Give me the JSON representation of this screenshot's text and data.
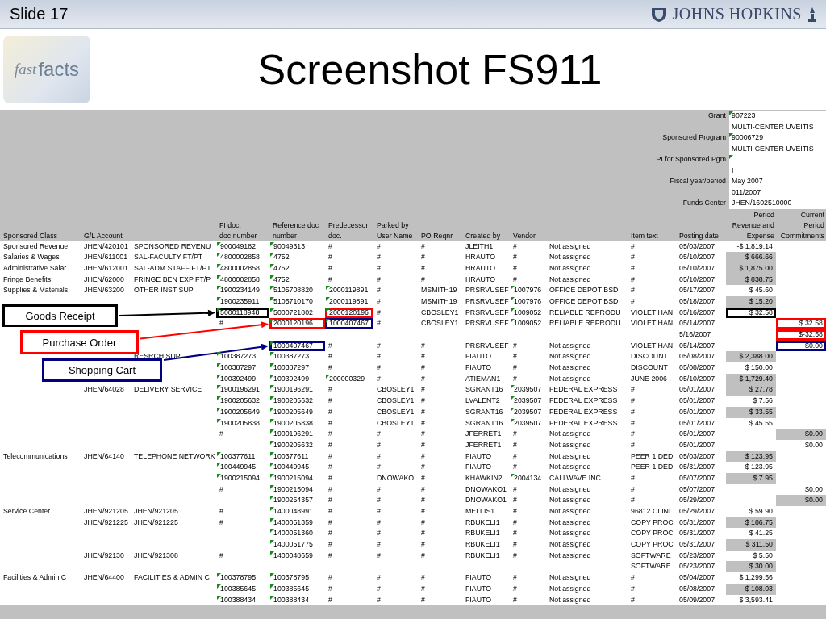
{
  "slide": {
    "label": "Slide 17",
    "brand": "JOHNS HOPKINS",
    "logo_words": [
      "fast",
      "facts"
    ],
    "title": "Screenshot FS911"
  },
  "report": {
    "info": [
      {
        "label": "Grant",
        "value": {
          "text": "907223",
          "flag": true
        }
      },
      {
        "value": "MULTI-CENTER UVEITIS"
      },
      {
        "label": "Sponsored Program",
        "value": {
          "text": "90006729",
          "flag": true
        }
      },
      {
        "value": "MULTI-CENTER UVEITIS"
      },
      {
        "label": "PI for Sponsored Pgm",
        "value": {
          "flag": true
        }
      },
      {
        "value": "I"
      },
      {
        "label": "Fiscal year/period",
        "value": "May 2007"
      },
      {
        "value": "011/2007"
      },
      {
        "label": "Funds Center",
        "value": "JHEN/1602510000"
      }
    ],
    "header": {
      "sponsored_class": "Sponsored Class",
      "gl_account": "G/L Account",
      "fi_doc": "FI doc:\ndoc.number",
      "reference_doc": "Reference doc\nnumber",
      "predecessor_doc": "Predecessor\ndoc.",
      "parked_by": "Parked by\nUser Name",
      "po_reqnr": "PO Reqnr",
      "created_by": "Created by",
      "vendor": "Vendor",
      "item_text": "Item text",
      "posting_date": "Posting date",
      "revenue_expense": "Period\nRevenue and\nExpense",
      "commitments": "Current\nPeriod\nCommitments"
    },
    "rows": [
      {
        "sponsored_class": "Sponsored Revenue",
        "gl_account": "JHEN/420101",
        "gl_account_text": "SPONSORED REVENU",
        "fi_doc": {
          "text": "900049182",
          "flag": true
        },
        "reference_doc": {
          "text": "90049313",
          "flag": true
        },
        "predecessor_doc": "#",
        "parked_by": "#",
        "po_reqnr": "#",
        "created_by": "JLEITH1",
        "vendor": "#",
        "vendor_name": "Not assigned",
        "item_text": "#",
        "posting_date": "05/03/2007",
        "revenue_expense": "-$ 1,819.14",
        "shaded": false
      },
      {
        "sponsored_class": "Salaries & Wages",
        "gl_account": "JHEN/611001",
        "gl_account_text": "SAL-FACULTY FT/PT",
        "fi_doc": {
          "text": "4800002858",
          "flag": true
        },
        "reference_doc": {
          "text": "4752",
          "flag": true
        },
        "predecessor_doc": "#",
        "parked_by": "#",
        "po_reqnr": "#",
        "created_by": "HRAUTO",
        "vendor": "#",
        "vendor_name": "Not assigned",
        "item_text": "#",
        "posting_date": "05/10/2007",
        "revenue_expense": "$ 666.66",
        "shaded": true
      },
      {
        "sponsored_class": "Administrative Salar",
        "gl_account": "JHEN/612001",
        "gl_account_text": "SAL-ADM STAFF FT/PT",
        "fi_doc": {
          "text": "4800002858",
          "flag": true
        },
        "reference_doc": {
          "text": "4752",
          "flag": true
        },
        "predecessor_doc": "#",
        "parked_by": "#",
        "po_reqnr": "#",
        "created_by": "HRAUTO",
        "vendor": "#",
        "vendor_name": "Not assigned",
        "item_text": "#",
        "posting_date": "05/10/2007",
        "revenue_expense": "$ 1,875.00",
        "shaded": true
      },
      {
        "sponsored_class": "Fringe Benefits",
        "gl_account": "JHEN/62000",
        "gl_account_text": "FRINGE BEN EXP FT/P",
        "fi_doc": {
          "text": "4800002858",
          "flag": true
        },
        "reference_doc": {
          "text": "4752",
          "flag": true
        },
        "predecessor_doc": "#",
        "parked_by": "#",
        "po_reqnr": "#",
        "created_by": "HRAUTO",
        "vendor": "#",
        "vendor_name": "Not assigned",
        "item_text": "#",
        "posting_date": "05/10/2007",
        "revenue_expense": "$ 838.75",
        "shaded": true
      },
      {
        "sponsored_class": "Supplies & Materials",
        "gl_account": "JHEN/63200",
        "gl_account_text": "OTHER INST SUP",
        "fi_doc": {
          "text": "1900234149",
          "flag": true
        },
        "reference_doc": {
          "text": "5105708820",
          "flag": true
        },
        "predecessor_doc": {
          "text": "2000119891",
          "flag": true
        },
        "parked_by": "#",
        "po_reqnr": "MSMITH19",
        "created_by": "PRSRVUSEF",
        "vendor": {
          "text": "1007976",
          "flag": true
        },
        "vendor_name": "OFFICE DEPOT BSD",
        "item_text": "#",
        "posting_date": "05/17/2007",
        "revenue_expense": "$ 45.60",
        "shaded": false
      },
      {
        "fi_doc": {
          "text": "1900235911",
          "flag": true
        },
        "reference_doc": {
          "text": "5105710170",
          "flag": true
        },
        "predecessor_doc": {
          "text": "2000119891",
          "flag": true
        },
        "parked_by": "#",
        "po_reqnr": "MSMITH19",
        "created_by": "PRSRVUSEF",
        "vendor": {
          "text": "1007976",
          "flag": true
        },
        "vendor_name": "OFFICE DEPOT BSD",
        "item_text": "#",
        "posting_date": "05/18/2007",
        "revenue_expense": "$ 15.20",
        "shaded": true
      },
      {
        "fi_doc": {
          "text": "5000118948",
          "flag": true,
          "color": "#000000"
        },
        "reference_doc": {
          "text": "5000721802",
          "flag": true
        },
        "predecessor_doc": {
          "text": "2000120196",
          "flag": true,
          "color": "#ff0000"
        },
        "parked_by": "#",
        "po_reqnr": "CBOSLEY1",
        "created_by": "PRSRVUSEF",
        "vendor": {
          "text": "1009052",
          "flag": true
        },
        "vendor_name": "RELIABLE REPRODU",
        "item_text": "VIOLET HAN",
        "posting_date": "05/16/2007",
        "revenue_expense": {
          "text": "$ 32.58",
          "color": "#000000"
        },
        "shaded": false
      },
      {
        "fi_doc": "#",
        "reference_doc": {
          "text": "2000120196",
          "flag": true,
          "color": "#ff0000"
        },
        "predecessor_doc": {
          "text": "1000407467",
          "flag": true,
          "color": "#000080"
        },
        "parked_by": "#",
        "po_reqnr": "CBOSLEY1",
        "created_by": "PRSRVUSEF",
        "vendor": {
          "text": "1009052",
          "flag": true
        },
        "vendor_name": "RELIABLE REPRODU",
        "item_text": "VIOLET HAN",
        "posting_date": "05/14/2007",
        "commitments": {
          "text": "$ 32.58",
          "color": "#ff0000"
        },
        "shaded": false
      },
      {
        "posting_date": "5/16/2007",
        "commitments": {
          "text": "$-32.58",
          "color": "#ff0000"
        },
        "shaded": false
      },
      {
        "reference_doc": {
          "text": "1000407467",
          "flag": true,
          "color": "#000080"
        },
        "predecessor_doc": "#",
        "parked_by": "#",
        "po_reqnr": "#",
        "created_by": "PRSRVUSEF",
        "vendor": "#",
        "vendor_name": "Not assigned",
        "item_text": "VIOLET HAN",
        "posting_date": "05/14/2007",
        "commitments": {
          "text": "$0.00",
          "color": "#000080"
        },
        "shaded": false
      },
      {
        "gl_account_text": "RESRCH SUP",
        "fi_doc": {
          "text": "100387273",
          "flag": true
        },
        "reference_doc": {
          "text": "100387273",
          "flag": true
        },
        "predecessor_doc": "#",
        "parked_by": "#",
        "po_reqnr": "#",
        "created_by": "FIAUTO",
        "vendor": "#",
        "vendor_name": "Not assigned",
        "item_text": "DISCOUNT",
        "posting_date": "05/08/2007",
        "revenue_expense": "$ 2,388.00",
        "shaded": true
      },
      {
        "fi_doc": {
          "text": "100387297",
          "flag": true
        },
        "reference_doc": {
          "text": "100387297",
          "flag": true
        },
        "predecessor_doc": "#",
        "parked_by": "#",
        "po_reqnr": "#",
        "created_by": "FIAUTO",
        "vendor": "#",
        "vendor_name": "Not assigned",
        "item_text": "DISCOUNT",
        "posting_date": "05/08/2007",
        "revenue_expense": "$ 150.00",
        "shaded": false
      },
      {
        "fi_doc": {
          "text": "100392499",
          "flag": true
        },
        "reference_doc": {
          "text": "100392499",
          "flag": true
        },
        "predecessor_doc": {
          "text": "200000329",
          "flag": true
        },
        "parked_by": "#",
        "po_reqnr": "#",
        "created_by": "ATIEMAN1",
        "vendor": "#",
        "vendor_name": "Not assigned",
        "item_text": "JUNE 2006 .",
        "posting_date": "05/10/2007",
        "revenue_expense": "$ 1,729.40",
        "shaded": true
      },
      {
        "gl_account": "JHEN/64028",
        "gl_account_text": "DELIVERY SERVICE",
        "fi_doc": {
          "text": "1900196291",
          "flag": true
        },
        "reference_doc": {
          "text": "1900196291",
          "flag": true
        },
        "predecessor_doc": "#",
        "parked_by": "CBOSLEY1",
        "po_reqnr": "#",
        "created_by": "SGRANT16",
        "vendor": {
          "text": "2039507",
          "flag": true
        },
        "vendor_name": "FEDERAL EXPRESS",
        "item_text": "#",
        "posting_date": "05/01/2007",
        "revenue_expense": "$ 27.78",
        "shaded": true
      },
      {
        "fi_doc": {
          "text": "1900205632",
          "flag": true
        },
        "reference_doc": {
          "text": "1900205632",
          "flag": true
        },
        "predecessor_doc": "#",
        "parked_by": "CBOSLEY1",
        "po_reqnr": "#",
        "created_by": "LVALENT2",
        "vendor": {
          "text": "2039507",
          "flag": true
        },
        "vendor_name": "FEDERAL EXPRESS",
        "item_text": "#",
        "posting_date": "05/01/2007",
        "revenue_expense": "$ 7.56",
        "shaded": false
      },
      {
        "fi_doc": {
          "text": "1900205649",
          "flag": true
        },
        "reference_doc": {
          "text": "1900205649",
          "flag": true
        },
        "predecessor_doc": "#",
        "parked_by": "CBOSLEY1",
        "po_reqnr": "#",
        "created_by": "SGRANT16",
        "vendor": {
          "text": "2039507",
          "flag": true
        },
        "vendor_name": "FEDERAL EXPRESS",
        "item_text": "#",
        "posting_date": "05/01/2007",
        "revenue_expense": "$ 33.55",
        "shaded": true
      },
      {
        "fi_doc": {
          "text": "1900205838",
          "flag": true
        },
        "reference_doc": {
          "text": "1900205838",
          "flag": true
        },
        "predecessor_doc": "#",
        "parked_by": "CBOSLEY1",
        "po_reqnr": "#",
        "created_by": "SGRANT16",
        "vendor": {
          "text": "2039507",
          "flag": true
        },
        "vendor_name": "FEDERAL EXPRESS",
        "item_text": "#",
        "posting_date": "05/01/2007",
        "revenue_expense": "$ 45.55",
        "shaded": false
      },
      {
        "fi_doc": "#",
        "reference_doc": {
          "text": "1900196291",
          "flag": true
        },
        "predecessor_doc": "#",
        "parked_by": "#",
        "po_reqnr": "#",
        "created_by": "JFERRET1",
        "vendor": "#",
        "vendor_name": "Not assigned",
        "item_text": "#",
        "posting_date": "05/01/2007",
        "commitments": "$0.00",
        "shaded": true
      },
      {
        "reference_doc": {
          "text": "1900205632",
          "flag": true
        },
        "predecessor_doc": "#",
        "parked_by": "#",
        "po_reqnr": "#",
        "created_by": "JFERRET1",
        "vendor": "#",
        "vendor_name": "Not assigned",
        "item_text": "#",
        "posting_date": "05/01/2007",
        "commitments": "$0.00",
        "shaded": false
      },
      {
        "sponsored_class": "Telecommunications",
        "gl_account": "JHEN/64140",
        "gl_account_text": "TELEPHONE NETWORK",
        "fi_doc": {
          "text": "100377611",
          "flag": true
        },
        "reference_doc": {
          "text": "100377611",
          "flag": true
        },
        "predecessor_doc": "#",
        "parked_by": "#",
        "po_reqnr": "#",
        "created_by": "FIAUTO",
        "vendor": "#",
        "vendor_name": "Not assigned",
        "item_text": "PEER 1 DEDI",
        "posting_date": "05/03/2007",
        "revenue_expense": "$ 123.95",
        "shaded": true
      },
      {
        "fi_doc": {
          "text": "100449945",
          "flag": true
        },
        "reference_doc": {
          "text": "100449945",
          "flag": true
        },
        "predecessor_doc": "#",
        "parked_by": "#",
        "po_reqnr": "#",
        "created_by": "FIAUTO",
        "vendor": "#",
        "vendor_name": "Not assigned",
        "item_text": "PEER 1 DEDI",
        "posting_date": "05/31/2007",
        "revenue_expense": "$ 123.95",
        "shaded": false
      },
      {
        "fi_doc": {
          "text": "1900215094",
          "flag": true
        },
        "reference_doc": {
          "text": "1900215094",
          "flag": true
        },
        "predecessor_doc": "#",
        "parked_by": "DNOWAKO",
        "po_reqnr": "#",
        "created_by": "KHAWKIN2",
        "vendor": {
          "text": "2004134",
          "flag": true
        },
        "vendor_name": "CALLWAVE INC",
        "item_text": "#",
        "posting_date": "05/07/2007",
        "revenue_expense": "$ 7.95",
        "shaded": true
      },
      {
        "fi_doc": "#",
        "reference_doc": {
          "text": "1900215094",
          "flag": true
        },
        "predecessor_doc": "#",
        "parked_by": "#",
        "po_reqnr": "#",
        "created_by": "DNOWAKO1",
        "vendor": "#",
        "vendor_name": "Not assigned",
        "item_text": "#",
        "posting_date": "05/07/2007",
        "commitments": "$0.00",
        "shaded": false
      },
      {
        "reference_doc": {
          "text": "1900254357",
          "flag": true
        },
        "predecessor_doc": "#",
        "parked_by": "#",
        "po_reqnr": "#",
        "created_by": "DNOWAKO1",
        "vendor": "#",
        "vendor_name": "Not assigned",
        "item_text": "#",
        "posting_date": "05/29/2007",
        "commitments": "$0.00",
        "shaded": true
      },
      {
        "sponsored_class": "Service Center",
        "gl_account": "JHEN/921205",
        "gl_account_text": "JHEN/921205",
        "fi_doc": "#",
        "reference_doc": {
          "text": "1400048991",
          "flag": true
        },
        "predecessor_doc": "#",
        "parked_by": "#",
        "po_reqnr": "#",
        "created_by": "MELLIS1",
        "vendor": "#",
        "vendor_name": "Not assigned",
        "item_text": "96812 CLINI",
        "posting_date": "05/29/2007",
        "revenue_expense": "$ 59.90",
        "shaded": false
      },
      {
        "gl_account": "JHEN/921225",
        "gl_account_text": "JHEN/921225",
        "fi_doc": "#",
        "reference_doc": {
          "text": "1400051359",
          "flag": true
        },
        "predecessor_doc": "#",
        "parked_by": "#",
        "po_reqnr": "#",
        "created_by": "RBUKELI1",
        "vendor": "#",
        "vendor_name": "Not assigned",
        "item_text": "COPY PROC",
        "posting_date": "05/31/2007",
        "revenue_expense": "$ 186.75",
        "shaded": true
      },
      {
        "reference_doc": {
          "text": "1400051360",
          "flag": true
        },
        "predecessor_doc": "#",
        "parked_by": "#",
        "po_reqnr": "#",
        "created_by": "RBUKELI1",
        "vendor": "#",
        "vendor_name": "Not assigned",
        "item_text": "COPY PROC",
        "posting_date": "05/31/2007",
        "revenue_expense": "$ 41.25",
        "shaded": false
      },
      {
        "reference_doc": {
          "text": "1400051775",
          "flag": true
        },
        "predecessor_doc": "#",
        "parked_by": "#",
        "po_reqnr": "#",
        "created_by": "RBUKELI1",
        "vendor": "#",
        "vendor_name": "Not assigned",
        "item_text": "COPY PROC",
        "posting_date": "05/31/2007",
        "revenue_expense": "$ 311.50",
        "shaded": true
      },
      {
        "gl_account": "JHEN/92130",
        "gl_account_text": "JHEN/921308",
        "fi_doc": "#",
        "reference_doc": {
          "text": "1400048659",
          "flag": true
        },
        "predecessor_doc": "#",
        "parked_by": "#",
        "po_reqnr": "#",
        "created_by": "RBUKELI1",
        "vendor": "#",
        "vendor_name": "Not assigned",
        "item_text": "SOFTWARE",
        "posting_date": "05/23/2007",
        "revenue_expense": "$ 5.50",
        "shaded": false
      },
      {
        "item_text": "SOFTWARE",
        "posting_date": "05/23/2007",
        "revenue_expense": "$ 30.00",
        "shaded": true
      },
      {
        "sponsored_class": "Facilities & Admin C",
        "gl_account": "JHEN/64400",
        "gl_account_text": "FACILITIES & ADMIN C",
        "fi_doc": {
          "text": "100378795",
          "flag": true
        },
        "reference_doc": {
          "text": "100378795",
          "flag": true
        },
        "predecessor_doc": "#",
        "parked_by": "#",
        "po_reqnr": "#",
        "created_by": "FIAUTO",
        "vendor": "#",
        "vendor_name": "Not assigned",
        "item_text": "#",
        "posting_date": "05/04/2007",
        "revenue_expense": "$ 1,299.56",
        "shaded": false
      },
      {
        "fi_doc": {
          "text": "100385645",
          "flag": true
        },
        "reference_doc": {
          "text": "100385645",
          "flag": true
        },
        "predecessor_doc": "#",
        "parked_by": "#",
        "po_reqnr": "#",
        "created_by": "FIAUTO",
        "vendor": "#",
        "vendor_name": "Not assigned",
        "item_text": "#",
        "posting_date": "05/08/2007",
        "revenue_expense": "$ 108.03",
        "shaded": true
      },
      {
        "fi_doc": {
          "text": "100388434",
          "flag": true
        },
        "reference_doc": {
          "text": "100388434",
          "flag": true
        },
        "predecessor_doc": "#",
        "parked_by": "#",
        "po_reqnr": "#",
        "created_by": "FIAUTO",
        "vendor": "#",
        "vendor_name": "Not assigned",
        "item_text": "#",
        "posting_date": "05/09/2007",
        "revenue_expense": "$ 3,593.41",
        "shaded": false
      }
    ],
    "callouts": [
      {
        "label": "Goods Receipt",
        "color": "#000000"
      },
      {
        "label": "Purchase Order",
        "color": "#ff0000"
      },
      {
        "label": "Shopping Cart",
        "color": "#000080"
      }
    ]
  }
}
